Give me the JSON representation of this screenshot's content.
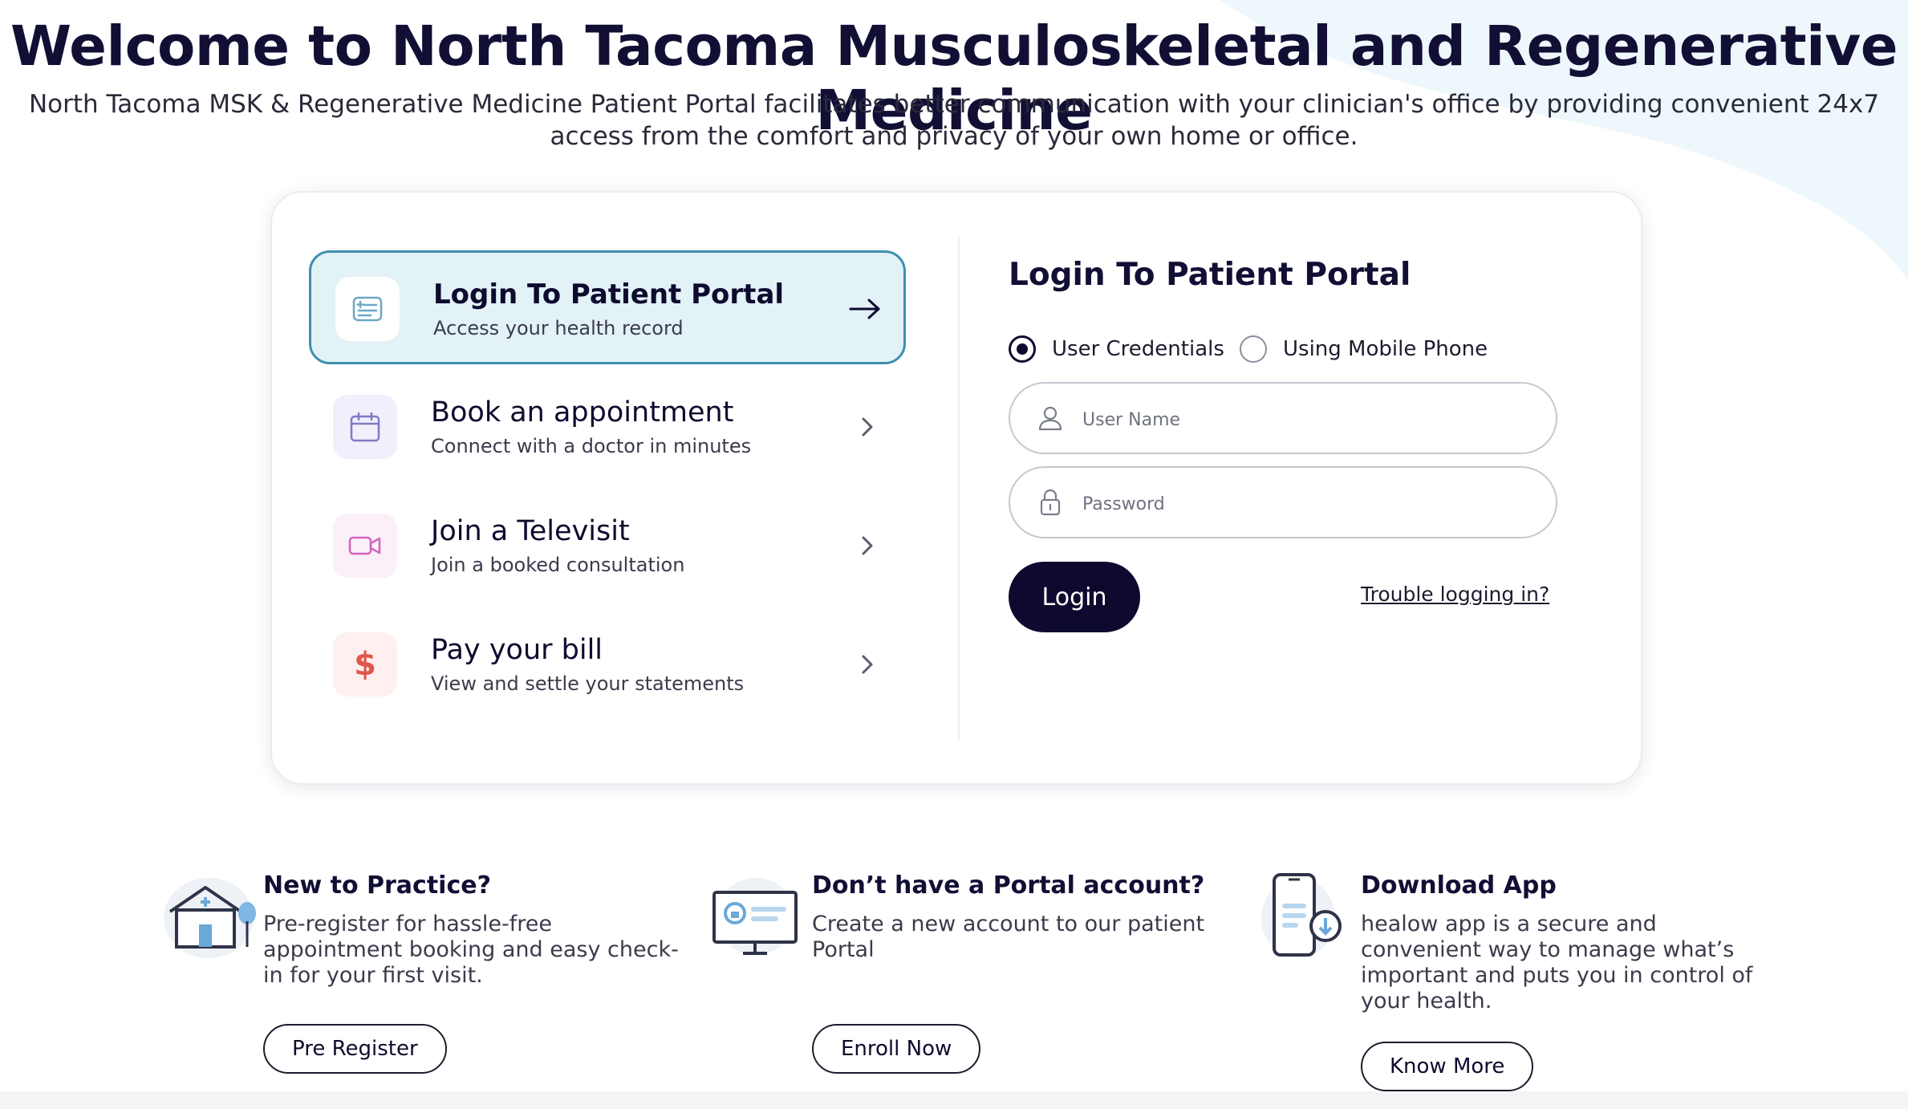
{
  "header": {
    "title": "Welcome to North Tacoma Musculoskeletal and Regenerative Medicine",
    "intro": "North Tacoma MSK & Regenerative Medicine Patient Portal facilitates better communication with your clinician's office by providing convenient 24x7 access from the comfort and privacy of your own home or office."
  },
  "menu": {
    "items": [
      {
        "title": "Login To Patient Portal",
        "subtitle": "Access your health record",
        "icon": "id-card-icon",
        "arrow": "arrow-right-icon",
        "active": true
      },
      {
        "title": "Book an appointment",
        "subtitle": "Connect with a doctor in minutes",
        "icon": "calendar-icon",
        "arrow": "chevron-right-icon"
      },
      {
        "title": "Join a Televisit",
        "subtitle": "Join a booked consultation",
        "icon": "video-camera-icon",
        "arrow": "chevron-right-icon"
      },
      {
        "title": "Pay your bill",
        "subtitle": "View and settle your statements",
        "icon": "dollar-icon",
        "arrow": "chevron-right-icon"
      }
    ]
  },
  "login": {
    "title": "Login To Patient Portal",
    "options": [
      {
        "label": "User Credentials",
        "selected": true
      },
      {
        "label": "Using Mobile Phone",
        "selected": false
      }
    ],
    "username": {
      "placeholder": "User Name",
      "value": "",
      "icon": "user-icon"
    },
    "password": {
      "placeholder": "Password",
      "value": "",
      "icon": "lock-icon"
    },
    "submit_label": "Login",
    "trouble_label": "Trouble logging in?"
  },
  "promos": [
    {
      "title": "New to Practice?",
      "text": "Pre-register for hassle-free appointment booking and easy check-in for your first visit.",
      "button": "Pre Register",
      "icon": "clinic-building-icon"
    },
    {
      "title": "Don’t have a Portal account?",
      "text": "Create a new account to our patient Portal",
      "button": "Enroll Now",
      "icon": "monitor-icon"
    },
    {
      "title": "Download App",
      "text": "healow app is a secure and convenient way to manage what’s important and puts you in control of your health.",
      "button": "Know More",
      "icon": "mobile-app-icon"
    }
  ],
  "colors": {
    "primary": "#0e0a2f",
    "active_bg": "#e2f2f7",
    "active_border": "#3e8fae",
    "background_swoosh": "#eef7fb"
  }
}
